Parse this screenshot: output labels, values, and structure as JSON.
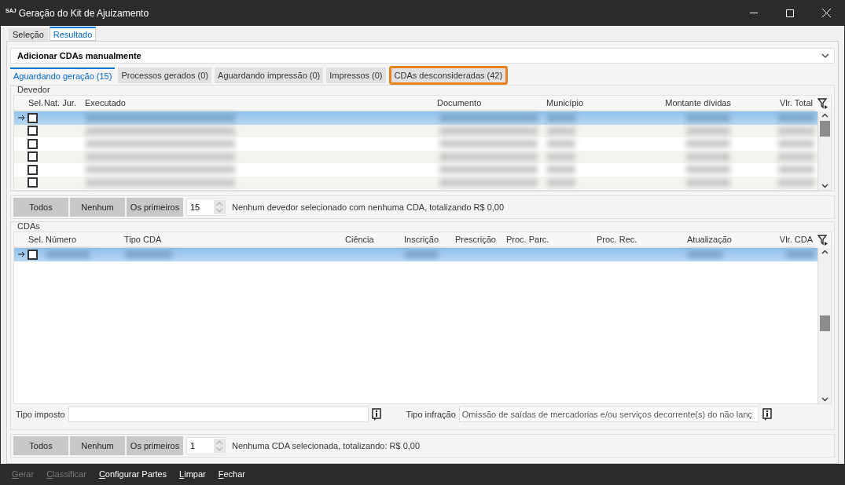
{
  "window": {
    "app_badge": "SAJ",
    "title": "Geração do Kit de Ajuizamento"
  },
  "main_tabs": [
    {
      "label": "Seleção",
      "selected": false
    },
    {
      "label": "Resultado",
      "selected": true
    }
  ],
  "expander": {
    "label": "Adicionar CDAs manualmente",
    "expanded": false
  },
  "result_tabs": [
    {
      "label": "Aguardando geração (15)",
      "selected": true,
      "highlighted": false
    },
    {
      "label": "Processos gerados (0)",
      "selected": false,
      "highlighted": false
    },
    {
      "label": "Aguardando impressão (0)",
      "selected": false,
      "highlighted": false
    },
    {
      "label": "Impressos (0)",
      "selected": false,
      "highlighted": false
    },
    {
      "label": "CDAs desconsideradas (42)",
      "selected": false,
      "highlighted": true
    }
  ],
  "devedor": {
    "title": "Devedor",
    "columns": [
      "Sel.",
      "Nat. Jur.",
      "Executado",
      "Documento",
      "Município",
      "Montante dívidas",
      "Vlr. Total"
    ],
    "rows": [
      {
        "selected": true,
        "checked": false
      },
      {
        "selected": false,
        "checked": false
      },
      {
        "selected": false,
        "checked": false
      },
      {
        "selected": false,
        "checked": false
      },
      {
        "selected": false,
        "checked": false
      },
      {
        "selected": false,
        "checked": false
      }
    ],
    "buttons": [
      "Todos",
      "Nenhum",
      "Os primeiros"
    ],
    "count": "15",
    "summary": "Nenhum devedor selecionado com nenhuma CDA, totalizando R$ 0,00"
  },
  "cdas": {
    "title": "CDAs",
    "columns": [
      "Sel.",
      "Número",
      "Tipo CDA",
      "Ciência",
      "Inscrição",
      "Prescrição",
      "Proc. Parc.",
      "Proc. Rec.",
      "Atualização",
      "Vlr. CDA"
    ],
    "rows": [
      {
        "selected": true,
        "checked": false
      }
    ],
    "tipo_imposto": {
      "label": "Tipo imposto"
    },
    "tipo_infracao": {
      "label": "Tipo infração",
      "value": "Omissão de saídas de mercadorias e/ou serviços decorrente(s) do não lanç"
    },
    "buttons": [
      "Todos",
      "Nenhum",
      "Os primeiros"
    ],
    "count": "1",
    "summary": "Nenhuma CDA selecionada, totalizando: R$ 0,00"
  },
  "footer": [
    {
      "label": "Gerar",
      "disabled": true
    },
    {
      "label": "Classificar",
      "disabled": true
    },
    {
      "label": "Configurar Partes",
      "disabled": false
    },
    {
      "label": "Limpar",
      "disabled": false
    },
    {
      "label": "Fechar",
      "disabled": false
    }
  ]
}
